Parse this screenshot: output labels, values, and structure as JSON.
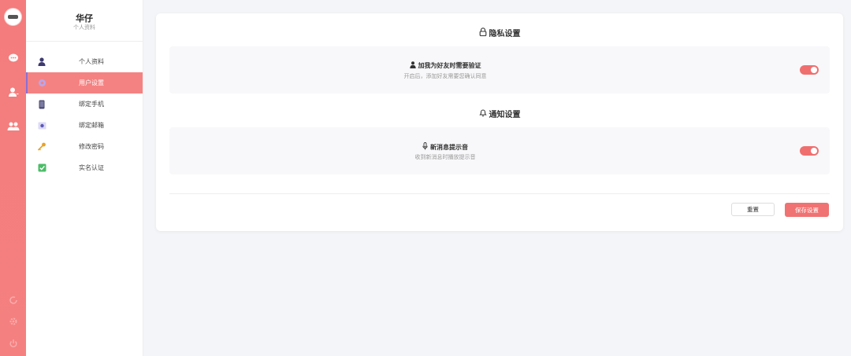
{
  "rail": {
    "avatar": "avatar",
    "icons": [
      "chat-icon",
      "contact-icon",
      "group-icon"
    ],
    "bottom_icons": [
      "refresh-icon",
      "gear-icon",
      "power-icon"
    ]
  },
  "profile": {
    "name": "华仔",
    "subtitle": "个人资料"
  },
  "menu": {
    "items": [
      {
        "label": "个人资料",
        "icon": "user-icon"
      },
      {
        "label": "用户设置",
        "icon": "settings-icon",
        "active": true
      },
      {
        "label": "绑定手机",
        "icon": "phone-icon"
      },
      {
        "label": "绑定邮箱",
        "icon": "email-icon"
      },
      {
        "label": "修改密码",
        "icon": "key-icon"
      },
      {
        "label": "实名认证",
        "icon": "check-icon"
      }
    ]
  },
  "privacy": {
    "title": "隐私设置",
    "setting": {
      "title": "加我为好友时需要验证",
      "desc": "开启后，添加好友需要您确认同意",
      "enabled": true
    }
  },
  "notify": {
    "title": "通知设置",
    "setting": {
      "title": "新消息提示音",
      "desc": "收到新消息时播放提示音",
      "enabled": true
    }
  },
  "actions": {
    "reset_label": "重置",
    "save_label": "保存设置"
  },
  "colors": {
    "accent": "#f47c7c",
    "toggle_on": "#ef6f6f",
    "active_marker": "#8a6fd6"
  }
}
